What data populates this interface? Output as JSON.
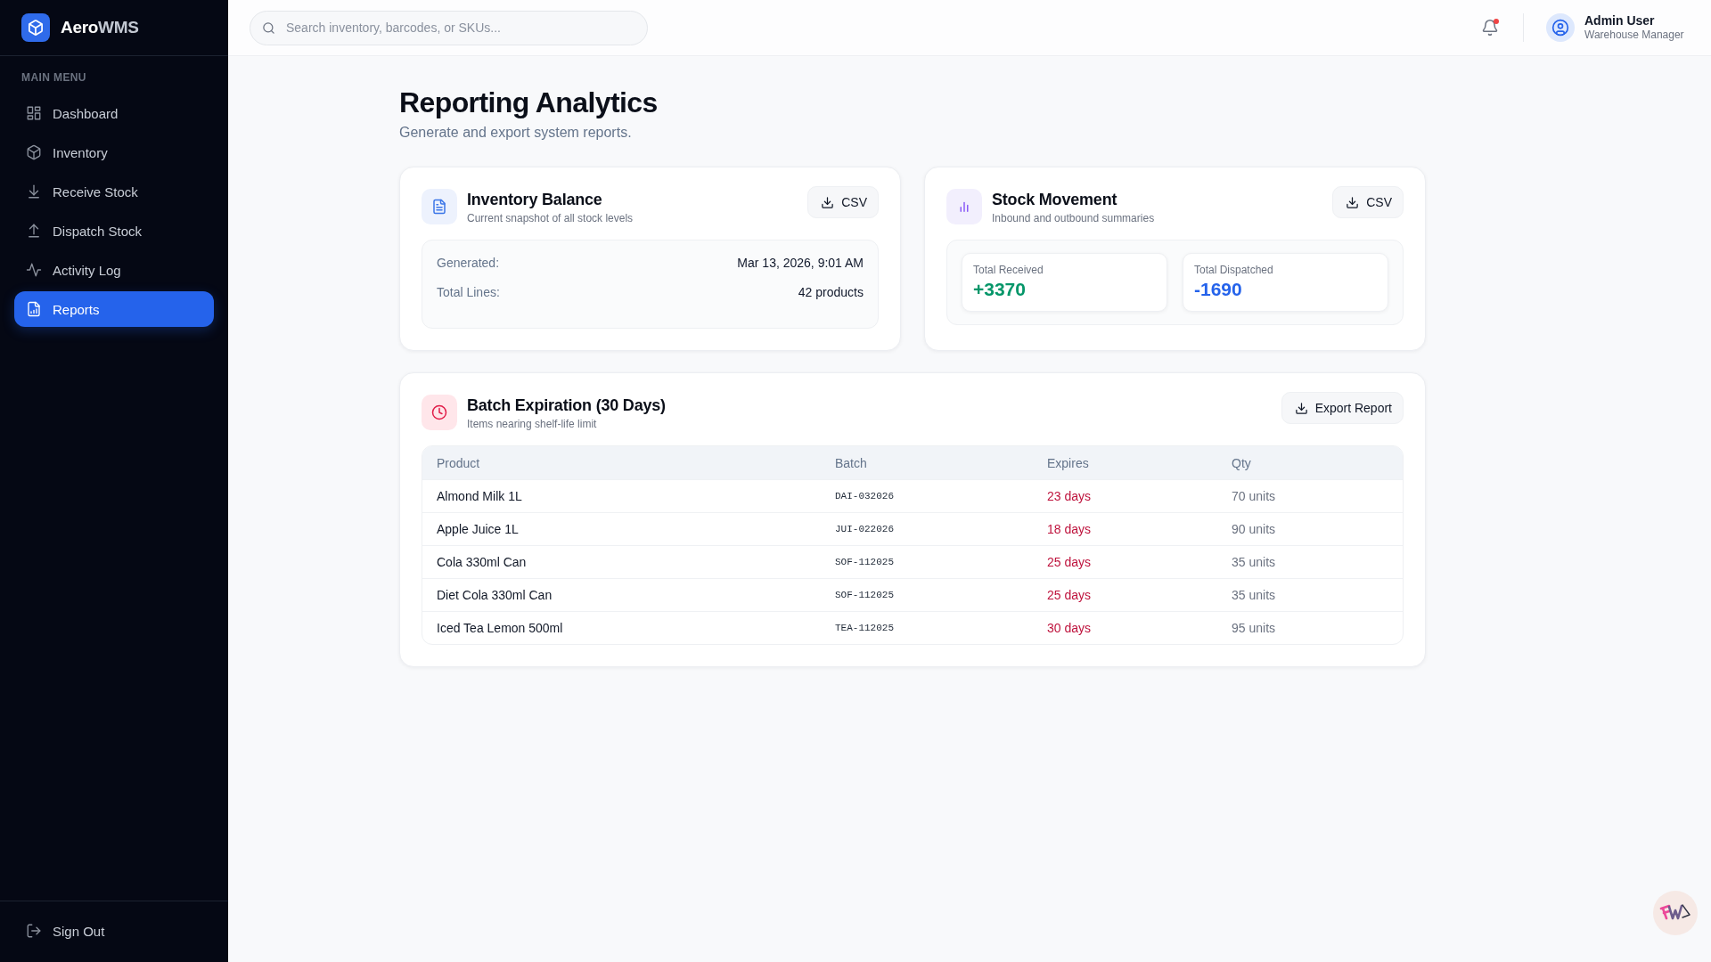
{
  "sidebar": {
    "brand": {
      "name": "Aero",
      "accent": "WMS"
    },
    "section_label": "MAIN MENU",
    "items": [
      {
        "label": "Dashboard",
        "selected": false
      },
      {
        "label": "Inventory",
        "selected": false
      },
      {
        "label": "Receive Stock",
        "selected": false
      },
      {
        "label": "Dispatch Stock",
        "selected": false
      },
      {
        "label": "Activity Log",
        "selected": false
      },
      {
        "label": "Reports",
        "selected": true
      }
    ],
    "footer_item": {
      "label": "Sign Out"
    }
  },
  "top_bar": {
    "search": {
      "placeholder": "Search inventory, barcodes, or SKUs..."
    },
    "notifications": {
      "unread": true
    },
    "user": {
      "name": "Admin User",
      "role": "Warehouse Manager"
    }
  },
  "page": {
    "title": "Reporting Analytics",
    "subtitle": "Generate and export system reports."
  },
  "inventory_balance": {
    "title": "Inventory Balance",
    "subtitle": "Current snapshot of all stock levels",
    "button": "CSV",
    "fields": [
      {
        "label": "Generated:",
        "value": "Mar 13, 2026, 9:01 AM"
      },
      {
        "label": "Total Lines:",
        "value": "42 products"
      }
    ]
  },
  "stock_movement": {
    "title": "Stock Movement",
    "subtitle": "Inbound and outbound summaries",
    "button": "CSV",
    "stats": [
      {
        "label": "Total Received",
        "value": "+3370",
        "color": "#059669"
      },
      {
        "label": "Total Dispatched",
        "value": "-1690",
        "color": "#2563eb"
      }
    ]
  },
  "batch_expiration": {
    "title": "Batch Expiration (30 Days)",
    "subtitle": "Items nearing shelf-life limit",
    "button": "Export Report",
    "table": {
      "columns": [
        "Product",
        "Batch",
        "Expires",
        "Qty"
      ],
      "rows": [
        {
          "product": "Almond Milk 1L",
          "batch": "DAI-032026",
          "expires": "23 days",
          "qty": "70 units"
        },
        {
          "product": "Apple Juice 1L",
          "batch": "JUI-022026",
          "expires": "18 days",
          "qty": "90 units"
        },
        {
          "product": "Cola 330ml Can",
          "batch": "SOF-112025",
          "expires": "25 days",
          "qty": "35 units"
        },
        {
          "product": "Diet Cola 330ml Can",
          "batch": "SOF-112025",
          "expires": "25 days",
          "qty": "35 units"
        },
        {
          "product": "Iced Tea Lemon 500ml",
          "batch": "TEA-112025",
          "expires": "30 days",
          "qty": "95 units"
        }
      ]
    }
  }
}
